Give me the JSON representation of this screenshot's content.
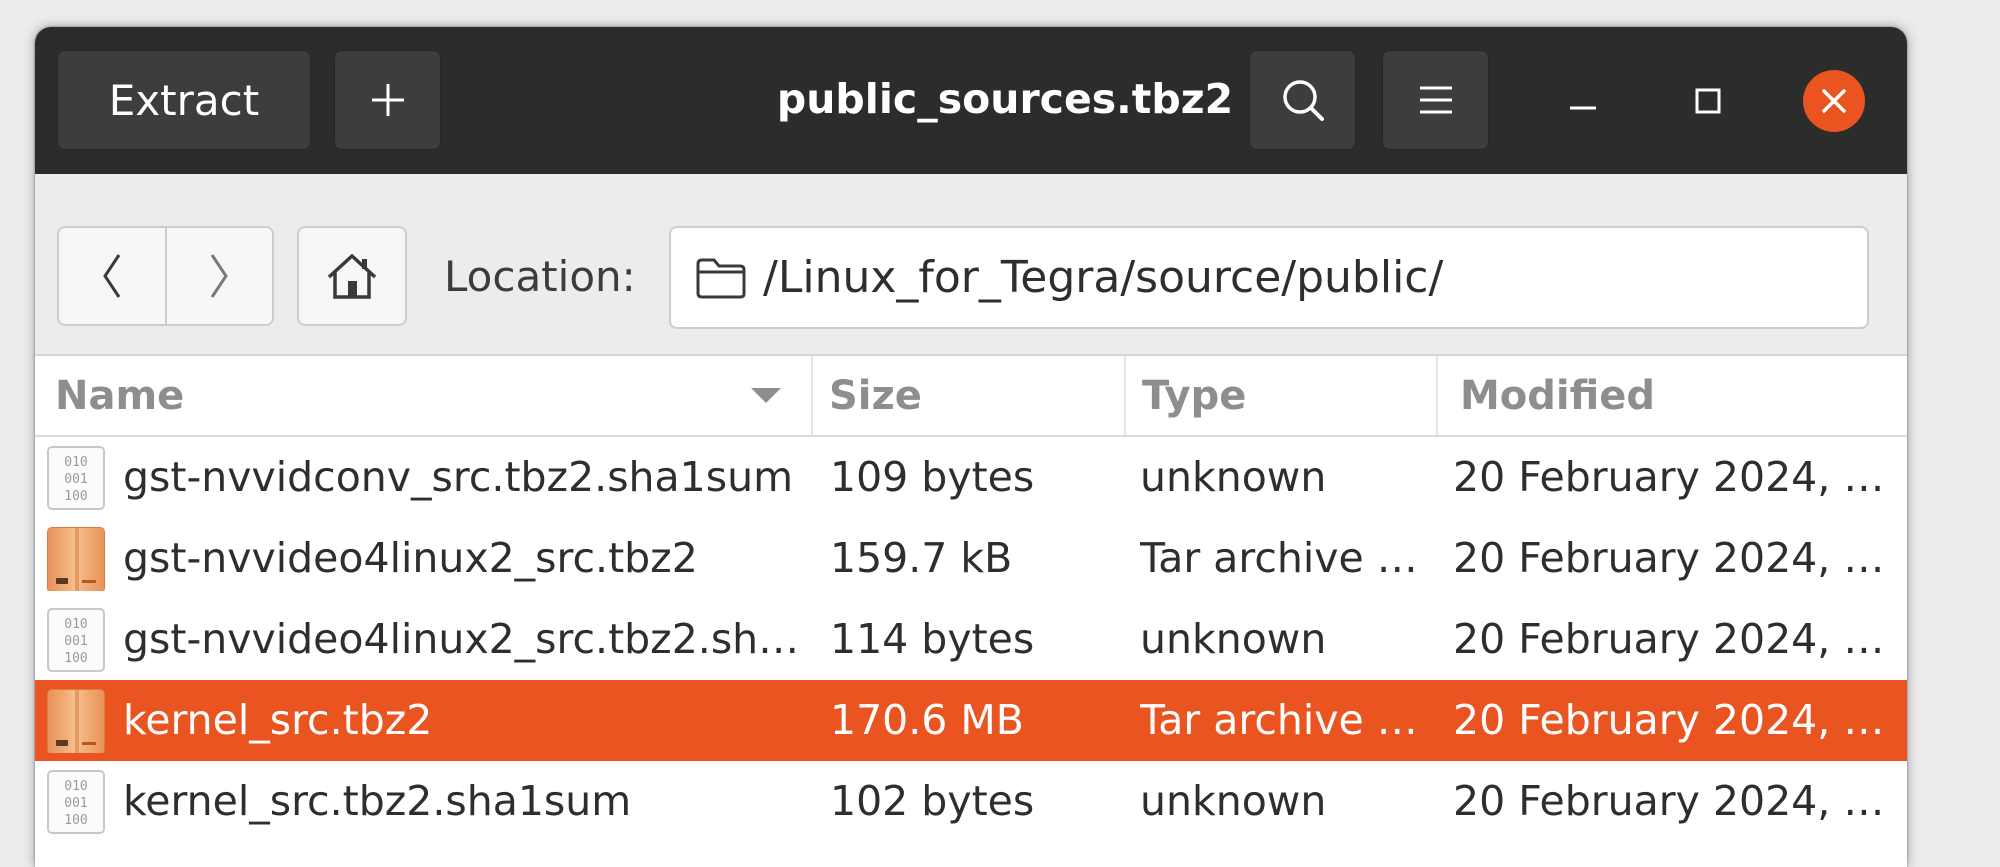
{
  "window": {
    "title": "public_sources.tbz2",
    "extract_label": "Extract"
  },
  "location": {
    "label": "Location:",
    "path": "/Linux_for_Tegra/source/public/"
  },
  "columns": {
    "name": "Name",
    "size": "Size",
    "type": "Type",
    "modified": "Modified",
    "sort_direction": "descending"
  },
  "rows": [
    {
      "icon": "text-file-icon",
      "name": "gst-nvvidconv_src.tbz2.sha1sum",
      "size": "109 bytes",
      "type": "unknown",
      "modified": "20 February 2024, …",
      "selected": false
    },
    {
      "icon": "archive-icon",
      "name": "gst-nvvideo4linux2_src.tbz2",
      "size": "159.7 kB",
      "type": "Tar archive …",
      "modified": "20 February 2024, …",
      "selected": false
    },
    {
      "icon": "text-file-icon",
      "name": "gst-nvvideo4linux2_src.tbz2.sh…",
      "size": "114 bytes",
      "type": "unknown",
      "modified": "20 February 2024, …",
      "selected": false
    },
    {
      "icon": "archive-icon",
      "name": "kernel_src.tbz2",
      "size": "170.6 MB",
      "type": "Tar archive …",
      "modified": "20 February 2024, …",
      "selected": true
    },
    {
      "icon": "text-file-icon",
      "name": "kernel_src.tbz2.sha1sum",
      "size": "102 bytes",
      "type": "unknown",
      "modified": "20 February 2024, …",
      "selected": false
    }
  ],
  "colors": {
    "accent": "#e95420",
    "headerbar": "#2c2c2c"
  }
}
